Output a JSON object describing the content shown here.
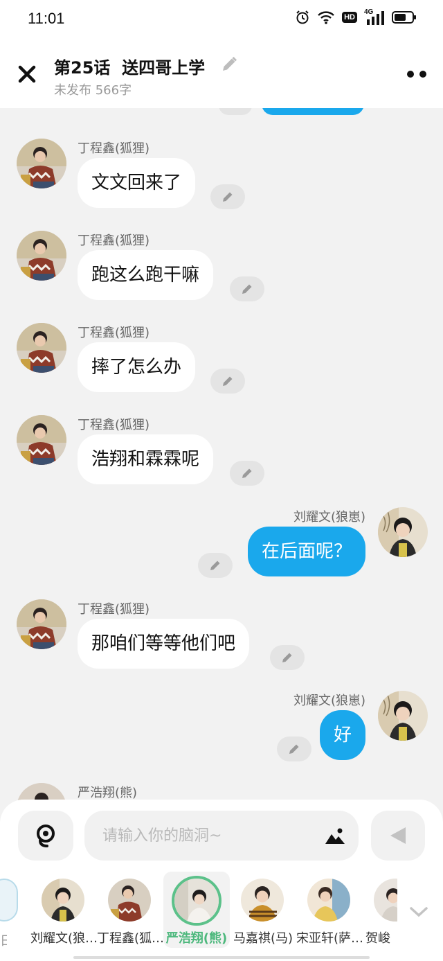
{
  "status": {
    "time": "11:01",
    "network": "4G",
    "hd": "HD"
  },
  "header": {
    "title": "第25话  送四哥上学",
    "subtitle": "未发布 566字"
  },
  "messages": [
    {
      "side": "left",
      "sender": "丁程鑫(狐狸)",
      "text": "文文回来了"
    },
    {
      "side": "left",
      "sender": "丁程鑫(狐狸)",
      "text": "跑这么跑干嘛"
    },
    {
      "side": "left",
      "sender": "丁程鑫(狐狸)",
      "text": "摔了怎么办"
    },
    {
      "side": "left",
      "sender": "丁程鑫(狐狸)",
      "text": "浩翔和霖霖呢"
    },
    {
      "side": "right",
      "sender": "刘耀文(狼崽)",
      "text": "在后面呢？"
    },
    {
      "side": "left",
      "sender": "丁程鑫(狐狸)",
      "text": "那咱们等等他们吧"
    },
    {
      "side": "right",
      "sender": "刘耀文(狼崽)",
      "text": "好"
    },
    {
      "side": "left",
      "sender": "严浩翔(熊)",
      "text": ""
    }
  ],
  "composer": {
    "placeholder": "请输入你的脑洞~"
  },
  "characters": [
    {
      "name": "刘耀文(狼…",
      "selected": false
    },
    {
      "name": "丁程鑫(狐…",
      "selected": false
    },
    {
      "name": "严浩翔(熊)",
      "selected": true
    },
    {
      "name": "马嘉祺(马)",
      "selected": false
    },
    {
      "name": "宋亚轩(萨…",
      "selected": false
    },
    {
      "name": "贺峻",
      "selected": false
    }
  ],
  "colors": {
    "accent_blue": "#1aa8ec",
    "selected_green": "#5cc18a"
  }
}
